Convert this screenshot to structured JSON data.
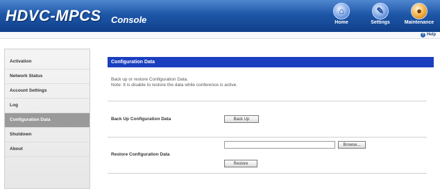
{
  "header": {
    "brand": "HDVC-MPCS",
    "subtitle": "Console",
    "icons": [
      {
        "name": "home-icon",
        "label": "Home",
        "glyph": "⌂",
        "color": "#7ea6e6"
      },
      {
        "name": "settings-icon",
        "label": "Settings",
        "glyph": "✎",
        "color": "#7ea6e6"
      },
      {
        "name": "maintenance-icon",
        "label": "Maintenance",
        "glyph": "●",
        "color": "#f1ac3c"
      }
    ],
    "help_label": "Help"
  },
  "sidebar": {
    "items": [
      {
        "label": "Activation"
      },
      {
        "label": "Network Status"
      },
      {
        "label": "Account Settings"
      },
      {
        "label": "Log"
      },
      {
        "label": "Configuration Data",
        "active": true
      },
      {
        "label": "Shutdown"
      },
      {
        "label": "About"
      }
    ]
  },
  "main": {
    "title": "Configuration Data",
    "desc_line1": "Back up or restore Configuration Data.",
    "desc_line2": "Note: It is disable to restore the data while conference is active.",
    "backup_label": "Back Up Configuration Data",
    "backup_button": "Back Up",
    "restore_label": "Restore Configuration Data",
    "browse_button": "Browse...",
    "restore_button": "Restore",
    "file_value": ""
  },
  "colors": {
    "header_blue": "#1e57a8",
    "title_bar": "#1a3fbf",
    "active_menu": "#9a9a9a"
  }
}
